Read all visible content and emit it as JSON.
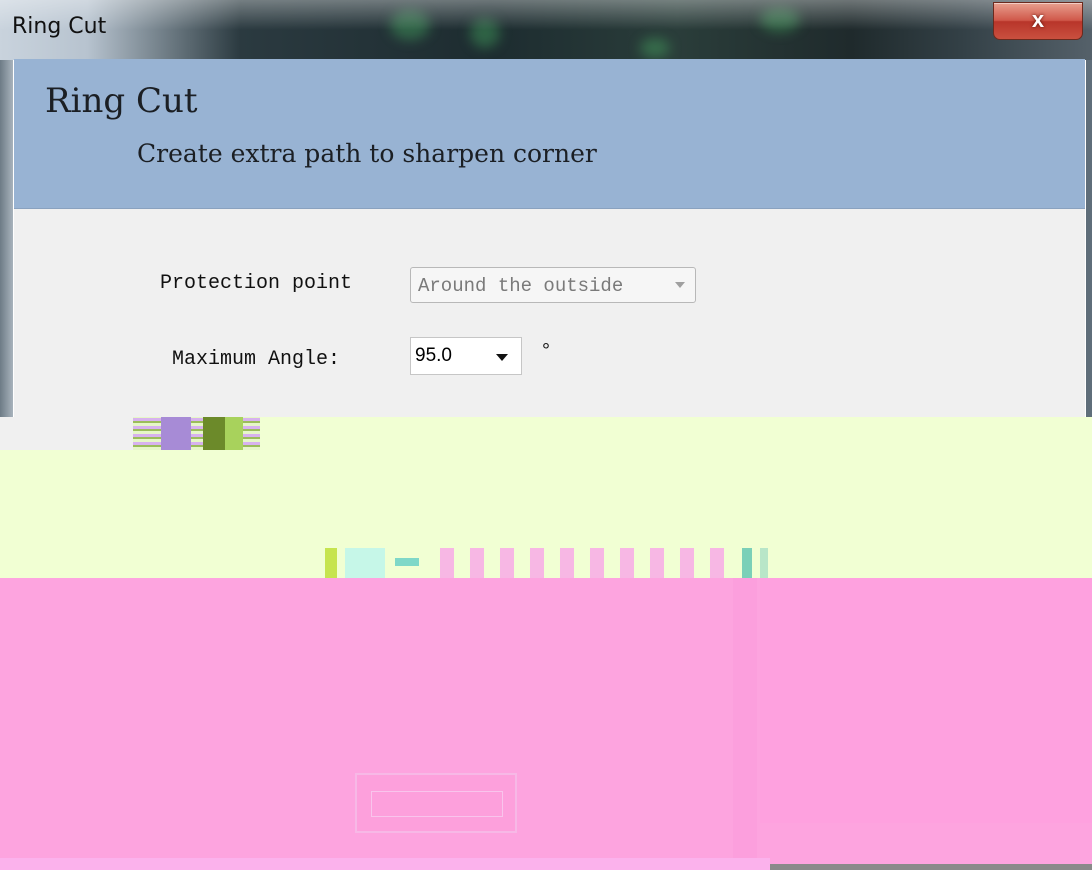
{
  "window": {
    "title": "Ring Cut",
    "close_symbol": "x"
  },
  "header": {
    "title": "Ring Cut",
    "subtitle": "Create extra path to sharpen corner"
  },
  "form": {
    "protection_point": {
      "label": "Protection point",
      "value": "Around the outside"
    },
    "maximum_angle": {
      "label": "Maximum Angle:",
      "value": "95.0",
      "unit": "°"
    }
  },
  "colors": {
    "header_bg": "#98b3d3",
    "form_bg": "#f0f0f0",
    "close_button": "#c9503f",
    "glitch_green": "#f1ffd3",
    "glitch_pink": "#fda4df"
  }
}
